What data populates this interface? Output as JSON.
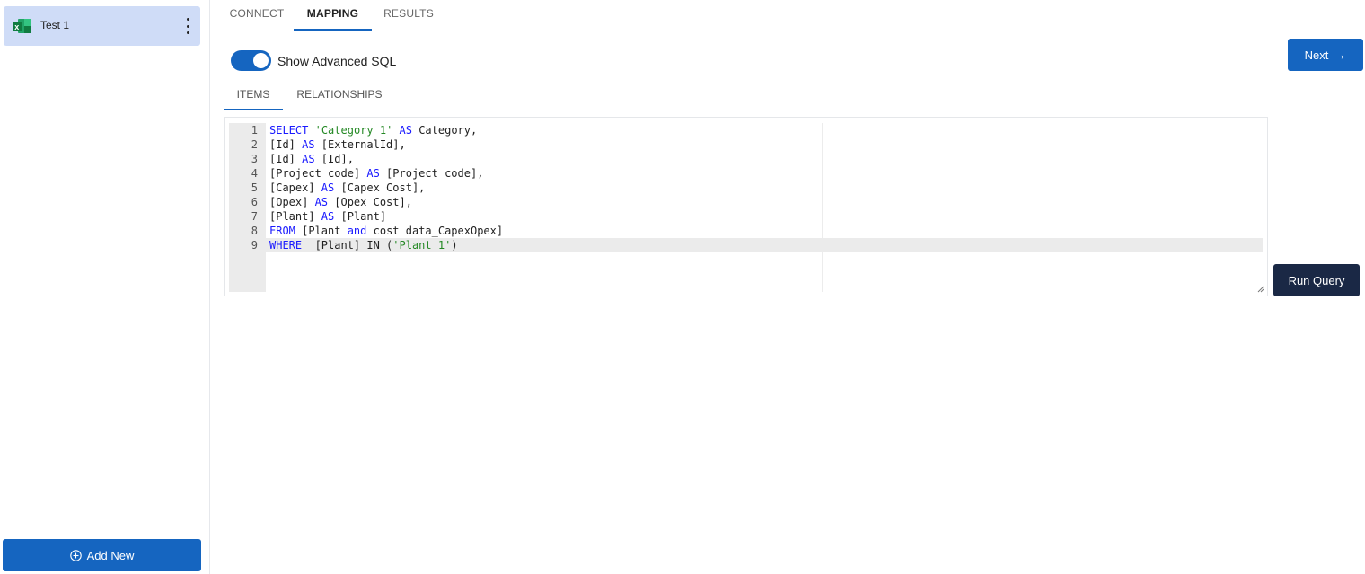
{
  "sidebar": {
    "sources": [
      {
        "label": "Test 1",
        "icon": "excel-icon"
      }
    ],
    "add_new_label": "Add New"
  },
  "top_tabs": [
    {
      "label": "CONNECT",
      "active": false
    },
    {
      "label": "MAPPING",
      "active": true
    },
    {
      "label": "RESULTS",
      "active": false
    }
  ],
  "next_button": {
    "label": "Next",
    "icon": "arrow-right-icon"
  },
  "toggle": {
    "label": "Show Advanced SQL",
    "on": true
  },
  "sub_tabs": [
    {
      "label": "ITEMS",
      "active": true
    },
    {
      "label": "RELATIONSHIPS",
      "active": false
    }
  ],
  "editor": {
    "current_line": 9,
    "lines": [
      {
        "n": "1",
        "tokens": [
          [
            "kw",
            "SELECT"
          ],
          [
            "t",
            " "
          ],
          [
            "str",
            "'Category 1'"
          ],
          [
            "t",
            " "
          ],
          [
            "kw",
            "AS"
          ],
          [
            "t",
            " Category,"
          ]
        ]
      },
      {
        "n": "2",
        "tokens": [
          [
            "t",
            "[Id] "
          ],
          [
            "kw",
            "AS"
          ],
          [
            "t",
            " [ExternalId],"
          ]
        ]
      },
      {
        "n": "3",
        "tokens": [
          [
            "t",
            "[Id] "
          ],
          [
            "kw",
            "AS"
          ],
          [
            "t",
            " [Id],"
          ]
        ]
      },
      {
        "n": "4",
        "tokens": [
          [
            "t",
            "[Project code] "
          ],
          [
            "kw",
            "AS"
          ],
          [
            "t",
            " [Project code],"
          ]
        ]
      },
      {
        "n": "5",
        "tokens": [
          [
            "t",
            "[Capex] "
          ],
          [
            "kw",
            "AS"
          ],
          [
            "t",
            " [Capex Cost],"
          ]
        ]
      },
      {
        "n": "6",
        "tokens": [
          [
            "t",
            "[Opex] "
          ],
          [
            "kw",
            "AS"
          ],
          [
            "t",
            " [Opex Cost],"
          ]
        ]
      },
      {
        "n": "7",
        "tokens": [
          [
            "t",
            "[Plant] "
          ],
          [
            "kw",
            "AS"
          ],
          [
            "t",
            " [Plant]"
          ]
        ]
      },
      {
        "n": "8",
        "tokens": [
          [
            "kw",
            "FROM"
          ],
          [
            "t",
            " [Plant "
          ],
          [
            "kw",
            "and"
          ],
          [
            "t",
            " cost data_CapexOpex]"
          ]
        ]
      },
      {
        "n": "9",
        "tokens": [
          [
            "kw",
            "WHERE"
          ],
          [
            "t",
            "  [Plant] IN ("
          ],
          [
            "str",
            "'Plant 1'"
          ],
          [
            "t",
            ")"
          ]
        ]
      }
    ]
  },
  "run_query_label": "Run Query",
  "colors": {
    "primary": "#1565c0",
    "dark": "#1a2845",
    "selected_bg": "#cfdcf7",
    "keyword": "#1a1aff",
    "string": "#238823"
  }
}
